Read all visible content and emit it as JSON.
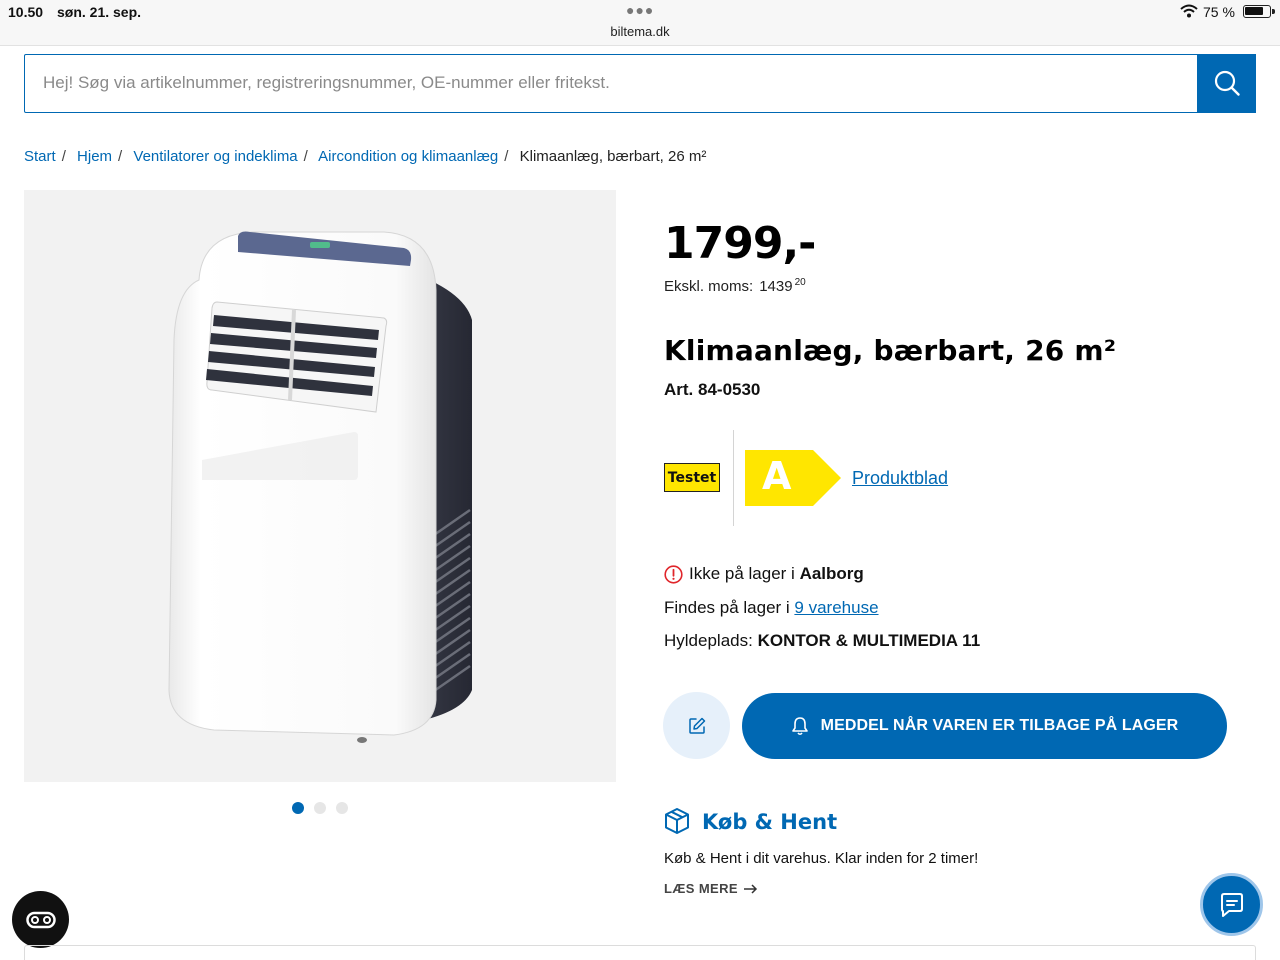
{
  "status_bar": {
    "time": "10.50",
    "date": "søn. 21. sep.",
    "url": "biltema.dk",
    "battery": "75 %",
    "battery_level": 0.75,
    "icons": [
      "wifi-icon",
      "battery-icon",
      "more-dots-icon"
    ]
  },
  "search": {
    "placeholder": "Hej! Søg via artikelnummer, registreringsnummer, OE-nummer eller fritekst.",
    "value": "",
    "button_icon": "search-icon"
  },
  "breadcrumb": {
    "items": [
      "Start",
      "Hjem",
      "Ventilatorer og indeklima",
      "Aircondition og klimaanlæg"
    ],
    "separator": "/",
    "current": "Klimaanlæg, bærbart, 26 m²"
  },
  "product": {
    "price": "1799,-",
    "exmoms_label": "Ekskl. moms:",
    "exmoms_amount": "1439",
    "exmoms_decimals": "20",
    "title": "Klimaanlæg, bærbart, 26 m²",
    "art_nr": "Art. 84-0530",
    "testet_badge": "Testet",
    "energy_class": "A",
    "produktblad": "Produktblad",
    "image_count": 3,
    "image_active_index": 0
  },
  "stock": {
    "not_in_stock_prefix": "Ikke på lager i ",
    "store": "Aalborg",
    "found_prefix": "Findes på lager i ",
    "found_link": "9 varehuse",
    "shelf_label": "Hyldeplads: ",
    "shelf_value": "KONTOR & MULTIMEDIA 11"
  },
  "actions": {
    "notify_label": "MEDDEL NÅR VAREN ER TILBAGE PÅ LAGER",
    "notify_icon": "bell-icon",
    "wishlist_icon": "edit-icon"
  },
  "kob_hent": {
    "title": "Køb & Hent",
    "text": "Køb & Hent i dit varehus. Klar inden for 2 timer!",
    "more": "LÆS MERE"
  },
  "colors": {
    "brand_blue": "#0068b3",
    "energy_yellow": "#ffe600",
    "warning_red": "#e0262b"
  }
}
